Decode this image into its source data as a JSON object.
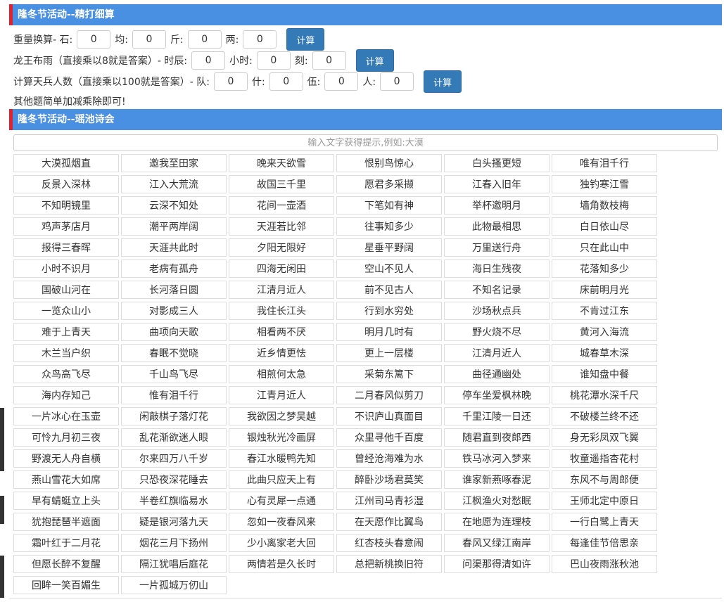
{
  "section1": {
    "title": "隆冬节活动--精打细算",
    "weight": {
      "label_prefix": "重量换算- 石:",
      "shi": "0",
      "jun_label": "均:",
      "jun": "0",
      "jin_label": "斤:",
      "jin": "0",
      "liang_label": "两:",
      "liang": "0",
      "button": "计算"
    },
    "rain": {
      "label_prefix": "龙王布雨（直接乘以8就是答案）- 时辰:",
      "shichen": "0",
      "hour_label": "小时:",
      "hour": "0",
      "ke_label": "刻:",
      "ke": "0",
      "button": "计算"
    },
    "soldiers": {
      "label_prefix": "计算天兵人数（直接乘以100就是答案）- 队:",
      "dui": "0",
      "shi_label": "什:",
      "shi": "0",
      "wu_label": "伍:",
      "wu": "0",
      "ren_label": "人:",
      "ren": "0",
      "button": "计算"
    },
    "note": "其他题简单加减乘除即可!"
  },
  "section2": {
    "title": "隆冬节活动--瑶池诗会",
    "search_placeholder": "输入文字获得提示,例如:大漠",
    "poems": [
      "大漠孤烟直",
      "邀我至田家",
      "晚来天欲雪",
      "恨别鸟惊心",
      "白头搔更短",
      "唯有泪千行",
      "反景入深林",
      "江入大荒流",
      "故国三千里",
      "愿君多采撷",
      "江春入旧年",
      "独钓寒江雪",
      "不知明镜里",
      "云深不知处",
      "花间一壶酒",
      "下笔如有神",
      "举杯邀明月",
      "墙角数枝梅",
      "鸡声茅店月",
      "潮平两岸阔",
      "天涯若比邻",
      "往事知多少",
      "此物最相思",
      "白日依山尽",
      "报得三春晖",
      "天涯共此时",
      "夕阳无限好",
      "星垂平野阔",
      "万里送行舟",
      "只在此山中",
      "小时不识月",
      "老病有孤舟",
      "四海无闲田",
      "空山不见人",
      "海日生残夜",
      "花落知多少",
      "国破山河在",
      "长河落日圆",
      "江清月近人",
      "前不见古人",
      "不知名记录",
      "床前明月光",
      "一览众山小",
      "对影成三人",
      "我住长江头",
      "行到水穷处",
      "沙场秋点兵",
      "不肯过江东",
      "难于上青天",
      "曲项向天歌",
      "相看两不厌",
      "明月几时有",
      "野火烧不尽",
      "黄河入海流",
      "木兰当户织",
      "春眠不觉晓",
      "近乡情更怯",
      "更上一层楼",
      "江清月近人",
      "城春草木深",
      "众鸟高飞尽",
      "千山鸟飞尽",
      "相煎何太急",
      "采菊东篱下",
      "曲径通幽处",
      "谁知盘中餐",
      "海内存知己",
      "惟有泪千行",
      "江青月近人",
      "二月春风似剪刀",
      "停车坐爱枫林晚",
      "桃花潭水深千尺",
      "一片冰心在玉壶",
      "闲敲棋子落灯花",
      "我欲因之梦吴越",
      "不识庐山真面目",
      "千里江陵一日还",
      "不破楼兰终不还",
      "可怜九月初三夜",
      "乱花渐欲迷人眼",
      "银烛秋光冷画屏",
      "众里寻他千百度",
      "随君直到夜郎西",
      "身无彩凤双飞翼",
      "野渡无人舟自横",
      "尔来四万八千岁",
      "春江水暖鸭先知",
      "曾经沧海难为水",
      "铁马冰河入梦来",
      "牧童遥指杏花村",
      "燕山雪花大如席",
      "只恐夜深花睡去",
      "此曲只应天上有",
      "醉卧沙场君莫笑",
      "谁家新燕啄春泥",
      "东风不与周郎便",
      "早有蜻蜓立上头",
      "半卷红旗临易水",
      "心有灵犀一点通",
      "江州司马青衫湿",
      "江枫渔火对愁眠",
      "王师北定中原日",
      "犹抱琵琶半遮面",
      "疑是银河落九天",
      "忽如一夜春风来",
      "在天愿作比翼鸟",
      "在地愿为连理枝",
      "一行白鹭上青天",
      "霜叶红于二月花",
      "烟花三月下扬州",
      "少小离家老大回",
      "红杏枝头春意闹",
      "春风又绿江南岸",
      "每逢佳节倍思亲",
      "但愿长醉不复醒",
      "隔江犹唱后庭花",
      "两情若是久长时",
      "总把新桃换旧符",
      "问渠那得清如许",
      "巴山夜雨涨秋池",
      "回眸一笑百媚生",
      "一片孤城万仞山"
    ]
  }
}
